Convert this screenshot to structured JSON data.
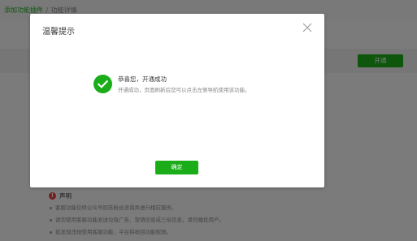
{
  "breadcrumb": {
    "link": "添加功能插件",
    "separator": "/",
    "current": "功能详情"
  },
  "background": {
    "open_button": "开通",
    "declaration": {
      "title": "声明",
      "items": [
        "客服功能仅供公众号回答粉丝咨询并进行相应服务。",
        "请勿使用客服功能发送垃圾广告、营销信息或三俗信息，请勿骚扰用户。",
        "如发现违规使用客服功能，平台将收回功能权限。"
      ]
    }
  },
  "dialog": {
    "title": "温馨提示",
    "status_title": "恭喜您，开通成功",
    "status_desc": "开通成功，页面刷新后您可以点击左侧导航使用该功能。",
    "confirm_label": "确定"
  },
  "colors": {
    "accent": "#1aad19",
    "warning": "#e64340",
    "overlay": "rgba(0,0,0,0.5)"
  },
  "icons": {
    "close": "close-icon",
    "success": "check-circle-icon",
    "warning": "exclamation-circle-icon"
  }
}
